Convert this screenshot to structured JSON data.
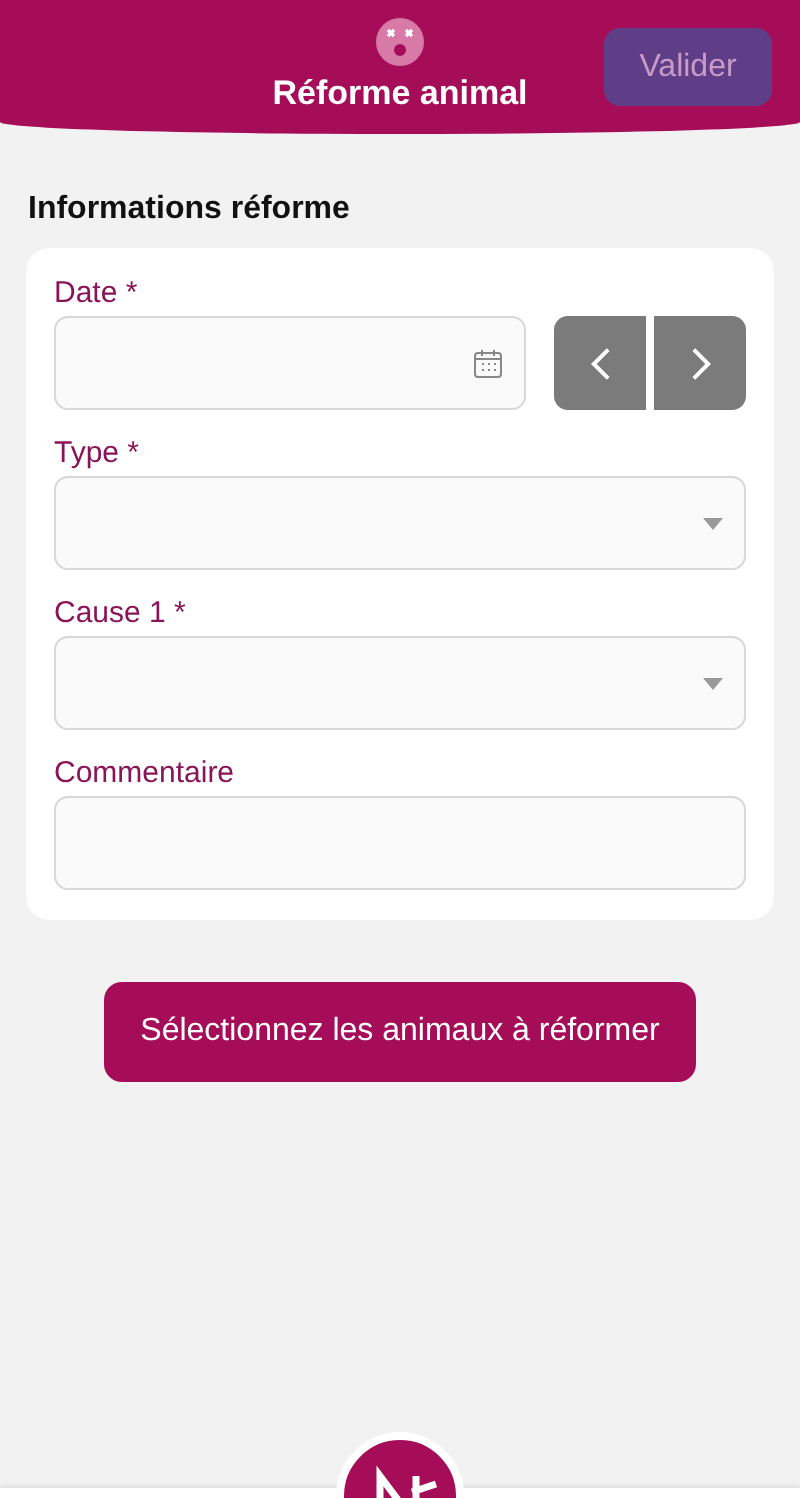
{
  "header": {
    "title": "Réforme animal",
    "action": {
      "label": "Valider",
      "disabled": true
    }
  },
  "section": {
    "title": "Informations réforme",
    "fields": [
      {
        "kind": "date",
        "label": "Date *"
      },
      {
        "kind": "select",
        "label": "Type *"
      },
      {
        "kind": "select",
        "label": "Cause 1 *"
      },
      {
        "kind": "text",
        "label": "Commentaire"
      }
    ]
  },
  "primary_button": "Sélectionnez les animaux à réformer"
}
